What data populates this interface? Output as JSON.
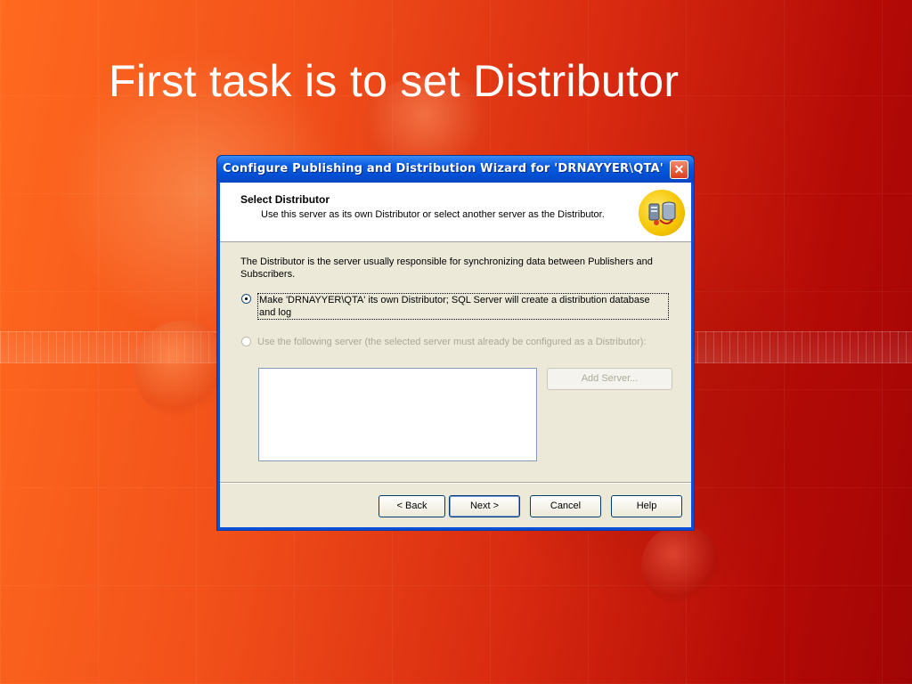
{
  "slide": {
    "title": "First task is to set Distributor"
  },
  "dialog": {
    "title": "Configure Publishing and Distribution Wizard for 'DRNAYYER\\QTA'",
    "close_glyph": "✕",
    "header": {
      "title": "Select Distributor",
      "subtitle": "Use this server as its own Distributor or select another server as the Distributor."
    },
    "description": "The Distributor is the server usually responsible for synchronizing data between Publishers and Subscribers.",
    "options": {
      "own_distributor": {
        "label": "Make 'DRNAYYER\\QTA' its own Distributor; SQL Server will create a distribution database and log",
        "checked": true
      },
      "other_server": {
        "label": "Use the following server (the selected server must already be configured as a Distributor):",
        "checked": false,
        "enabled": false
      }
    },
    "buttons": {
      "add_server": "Add Server...",
      "back": "< Back",
      "next": "Next >",
      "cancel": "Cancel",
      "help": "Help"
    }
  },
  "icons": {
    "close": "close-icon",
    "wizard": "server-replication-icon"
  }
}
